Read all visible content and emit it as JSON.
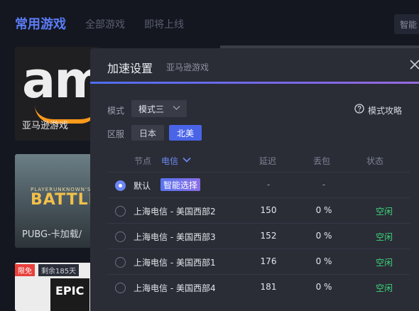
{
  "background": {
    "tabs": [
      {
        "label": "常用游戏",
        "active": true
      },
      {
        "label": "全部游戏",
        "active": false
      },
      {
        "label": "即将上线",
        "active": false
      }
    ],
    "smart_button": "智能",
    "cards": [
      {
        "title": "亚马逊游戏",
        "logo_text": "am"
      },
      {
        "title": "PUBG-卡加载/",
        "logo_small": "PLAYERUNKNOWN'S",
        "logo_text": "BATTLEGRO"
      },
      {
        "tag": "限免",
        "days": "剩余185天",
        "logo_text": "EPIC"
      }
    ]
  },
  "modal": {
    "title": "加速设置",
    "subtitle": "亚马逊游戏",
    "close_icon": "close-icon",
    "mode_label": "模式",
    "mode_value": "模式三",
    "guide_label": "模式攻略",
    "region_label": "区服",
    "regions": [
      {
        "label": "日本",
        "selected": false
      },
      {
        "label": "北美",
        "selected": true
      }
    ],
    "columns": {
      "node": "节点",
      "isp": "电信",
      "latency": "延迟",
      "loss": "丢包",
      "status": "状态"
    },
    "rows": [
      {
        "name": "默认",
        "badge": "智能选择",
        "latency": "-",
        "loss": "-",
        "status": "",
        "selected": true
      },
      {
        "name": "上海电信 - 美国西部2",
        "latency": "150",
        "loss": "0 %",
        "status": "空闲",
        "selected": false
      },
      {
        "name": "上海电信 - 美国西部3",
        "latency": "152",
        "loss": "0 %",
        "status": "空闲",
        "selected": false
      },
      {
        "name": "上海电信 - 美国西部1",
        "latency": "176",
        "loss": "0 %",
        "status": "空闲",
        "selected": false
      },
      {
        "name": "上海电信 - 美国西部4",
        "latency": "181",
        "loss": "0 %",
        "status": "空闲",
        "selected": false
      }
    ]
  },
  "colors": {
    "accent": "#4a64e8",
    "status_idle": "#3ed27a",
    "background": "#141720",
    "modal_bg": "#2a2d36"
  }
}
